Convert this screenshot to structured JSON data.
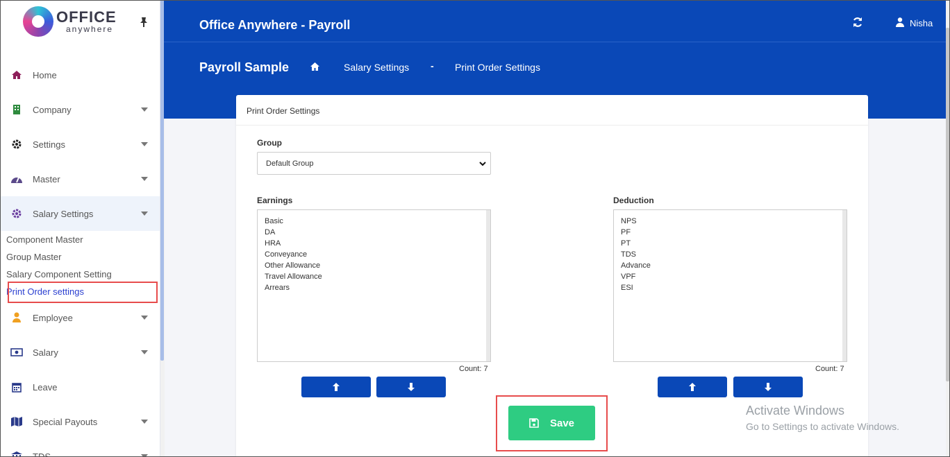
{
  "logo": {
    "big": "OFFICE",
    "small": "anywhere"
  },
  "header": {
    "app_title": "Office Anywhere - Payroll",
    "user_name": "Nisha"
  },
  "breadcrumb": {
    "page_title": "Payroll Sample",
    "crumb_1": "Salary Settings",
    "separator": "-",
    "crumb_2": "Print Order Settings"
  },
  "sidebar": {
    "items": [
      {
        "label": "Home",
        "icon": "home-icon"
      },
      {
        "label": "Company",
        "icon": "building-icon"
      },
      {
        "label": "Settings",
        "icon": "gear-icon"
      },
      {
        "label": "Master",
        "icon": "dashboard-icon"
      },
      {
        "label": "Salary Settings",
        "icon": "cog-icon"
      },
      {
        "label": "Employee",
        "icon": "user-icon"
      },
      {
        "label": "Salary",
        "icon": "money-icon"
      },
      {
        "label": "Leave",
        "icon": "calendar-icon"
      },
      {
        "label": "Special Payouts",
        "icon": "map-icon"
      },
      {
        "label": "TDS",
        "icon": "bank-icon"
      }
    ],
    "sub_items": [
      "Component Master",
      "Group Master",
      "Salary Component Setting",
      "Print Order settings"
    ]
  },
  "card": {
    "title": "Print Order Settings",
    "group_label": "Group",
    "group_value": "Default Group",
    "earnings_label": "Earnings",
    "deduction_label": "Deduction",
    "earnings": [
      "Basic",
      "DA",
      "HRA",
      "Conveyance",
      "Other Allowance",
      "Travel Allowance",
      "Arrears"
    ],
    "deductions": [
      "NPS",
      "PF",
      "PT",
      "TDS",
      "Advance",
      "VPF",
      "ESI"
    ],
    "earnings_count": "Count: 7",
    "deduction_count": "Count: 7",
    "save_label": "Save"
  },
  "watermark": {
    "line1": "Activate Windows",
    "line2": "Go to Settings to activate Windows."
  },
  "colors": {
    "primary": "#0a48b7",
    "save": "#2ecc82",
    "highlight": "#e74c4c"
  }
}
